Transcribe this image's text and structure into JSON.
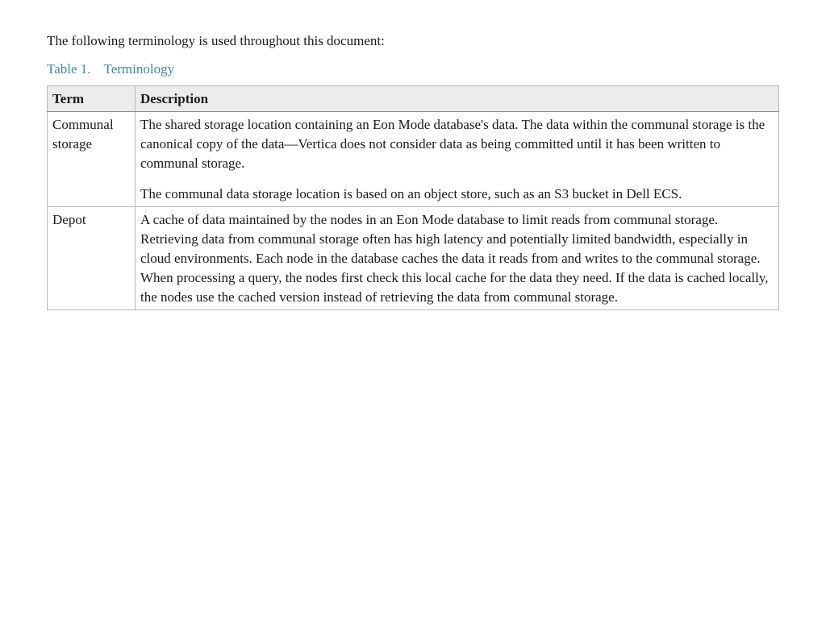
{
  "intro": "The following terminology is used throughout this document:",
  "caption": {
    "number": "Table 1.",
    "title": "Terminology"
  },
  "headers": {
    "term": "Term",
    "description": "Description"
  },
  "rows": [
    {
      "term": "Communal storage",
      "description": [
        "The shared storage location containing an Eon Mode database's data. The data within the communal storage is the canonical copy of the data—Vertica does not consider data as being committed until it has been written to communal storage.",
        "The communal data storage location is based on an object store, such as an S3 bucket in Dell ECS."
      ]
    },
    {
      "term": "Depot",
      "description": [
        "A cache of data maintained by the nodes in an Eon Mode database to limit reads from communal storage. Retrieving data from communal storage often has high latency and potentially limited bandwidth, especially in cloud environments. Each node in the database caches the data it reads from and writes to the communal storage. When processing a query, the nodes first check this local cache for the data they need. If the data is cached locally, the nodes use the cached version instead of retrieving the data from communal storage."
      ]
    }
  ]
}
